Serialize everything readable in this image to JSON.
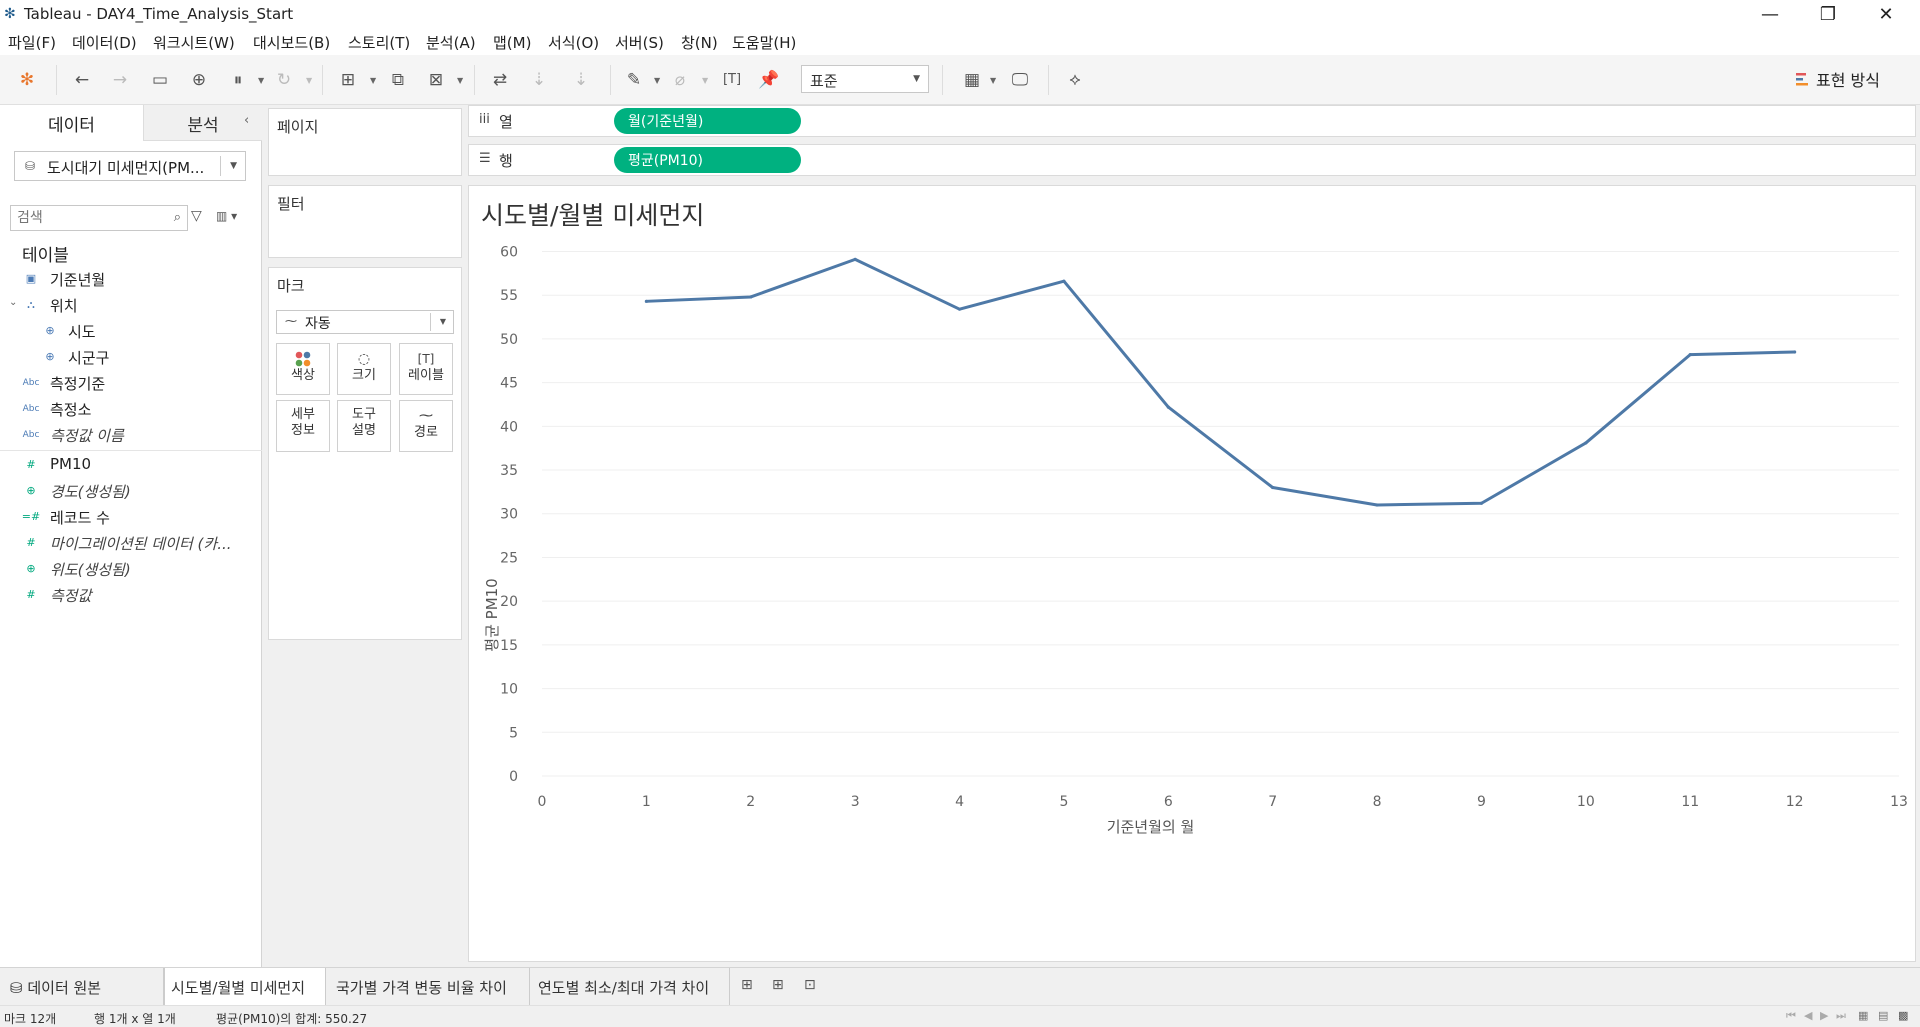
{
  "window": {
    "title": "Tableau - DAY4_Time_Analysis_Start",
    "minimize": "—",
    "restore": "❐",
    "close": "✕"
  },
  "menu": [
    "파일(F)",
    "데이터(D)",
    "워크시트(W)",
    "대시보드(B)",
    "스토리(T)",
    "분석(A)",
    "맵(M)",
    "서식(O)",
    "서버(S)",
    "창(N)",
    "도움말(H)"
  ],
  "toolbar": {
    "fit": "표준",
    "show_me": "표현 방식"
  },
  "data_pane": {
    "tabs": [
      "데이터",
      "분석"
    ],
    "datasource": "도시대기 미세먼지(PM...",
    "search_placeholder": "검색",
    "section": "테이블",
    "fields": [
      {
        "label": "기준년월",
        "icon": "calendar-icon",
        "italic": false
      },
      {
        "label": "위치",
        "icon": "hierarchy-icon",
        "italic": false
      },
      {
        "label": "시도",
        "icon": "globe-icon",
        "italic": false
      },
      {
        "label": "시군구",
        "icon": "globe-icon",
        "italic": false
      },
      {
        "label": "측정기준",
        "icon": "abc-icon",
        "italic": false
      },
      {
        "label": "측정소",
        "icon": "abc-icon",
        "italic": false
      },
      {
        "label": "측정값 이름",
        "icon": "abc-icon",
        "italic": true
      },
      {
        "label": "PM10",
        "icon": "number-icon",
        "italic": false
      },
      {
        "label": "경도(생성됨)",
        "icon": "globe-icon",
        "italic": true
      },
      {
        "label": "레코드 수",
        "icon": "number-icon",
        "italic": false
      },
      {
        "label": "마이그레이션된 데이터 (카...",
        "icon": "number-icon",
        "italic": true
      },
      {
        "label": "위도(생성됨)",
        "icon": "globe-icon",
        "italic": true
      },
      {
        "label": "측정값",
        "icon": "number-icon",
        "italic": true
      }
    ]
  },
  "cards": {
    "pages": "페이지",
    "filters": "필터",
    "marks": "마크",
    "mark_type": "자동",
    "mark_buttons": [
      "색상",
      "크기",
      "레이블",
      "세부\n정보",
      "도구\n설명",
      "경로"
    ]
  },
  "shelves": {
    "columns_label": "열",
    "columns_pill": "월(기준년월)",
    "rows_label": "행",
    "rows_pill": "평균(PM10)"
  },
  "viz_title": "시도별/월별 미세먼지",
  "chart_data": {
    "type": "line",
    "title": "시도별/월별 미세먼지",
    "xlabel": "기준년월의 월",
    "ylabel": "평균 PM10",
    "x": [
      1,
      2,
      3,
      4,
      5,
      6,
      7,
      8,
      9,
      10,
      11,
      12
    ],
    "series": [
      {
        "values": [
          54.3,
          54.8,
          59.1,
          53.4,
          56.6,
          42.2,
          33.0,
          31.0,
          31.2,
          38.1,
          48.2,
          48.5
        ]
      }
    ],
    "xlim": [
      0,
      13
    ],
    "ylim": [
      0,
      62
    ],
    "xticks": [
      0,
      1,
      2,
      3,
      4,
      5,
      6,
      7,
      8,
      9,
      10,
      11,
      12,
      13
    ],
    "yticks": [
      0,
      5,
      10,
      15,
      20,
      25,
      30,
      35,
      40,
      45,
      50,
      55,
      60
    ],
    "line_color": "#4e79a7",
    "grid": true
  },
  "sheet_tabs": {
    "data_source": "데이터 원본",
    "sheets": [
      "시도별/월별 미세먼지",
      "국가별 가격 변동 비율 차이",
      "연도별 최소/최대 가격 차이"
    ]
  },
  "status": {
    "marks": "마크 12개",
    "rows_cols": "행 1개 x 열 1개",
    "sum": "평균(PM10)의 합계: 550.27"
  }
}
